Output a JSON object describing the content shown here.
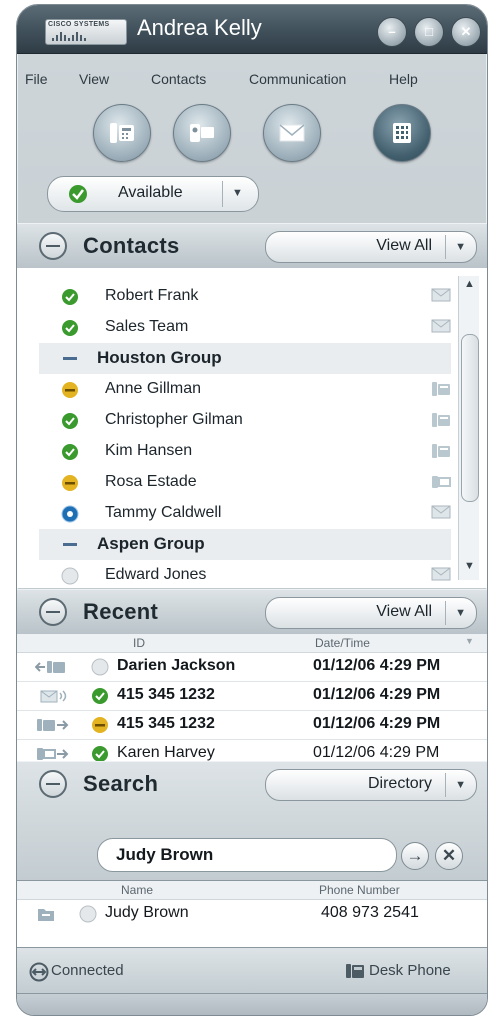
{
  "window": {
    "logo_text": "CISCO SYSTEMS",
    "title": "Andrea Kelly",
    "minimize_glyph": "–",
    "restore_glyph": "□",
    "close_glyph": "✕"
  },
  "menu": [
    "File",
    "View",
    "Contacts",
    "Communication",
    "Help"
  ],
  "toolbar_buttons": [
    "desk-phone-icon",
    "video-icon",
    "email-icon",
    "keypad-icon"
  ],
  "status": {
    "label": "Available",
    "icon": "status-available-icon"
  },
  "contacts": {
    "title": "Contacts",
    "filter": "View All",
    "rows": [
      {
        "type": "contact",
        "name": "Robert Frank",
        "status": "available",
        "icon": "email-icon"
      },
      {
        "type": "contact",
        "name": "Sales Team",
        "status": "available",
        "icon": "email-icon"
      },
      {
        "type": "group",
        "name": "Houston Group"
      },
      {
        "type": "contact",
        "name": "Anne Gillman",
        "status": "away",
        "icon": "phone-icon"
      },
      {
        "type": "contact",
        "name": "Christopher Gilman",
        "status": "available",
        "icon": "phone-icon"
      },
      {
        "type": "contact",
        "name": "Kim Hansen",
        "status": "available",
        "icon": "phone-icon"
      },
      {
        "type": "contact",
        "name": "Rosa Estade",
        "status": "away",
        "icon": "video-icon"
      },
      {
        "type": "contact",
        "name": "Tammy Caldwell",
        "status": "busy",
        "icon": "email-icon"
      },
      {
        "type": "group",
        "name": "Aspen Group"
      },
      {
        "type": "contact",
        "name": "Edward Jones",
        "status": "offline",
        "icon": "email-icon"
      }
    ]
  },
  "recent": {
    "title": "Recent",
    "filter": "View All",
    "columns": {
      "id": "ID",
      "datetime": "Date/Time"
    },
    "rows": [
      {
        "kind": "missed-call",
        "status": "offline",
        "id": "Darien Jackson",
        "datetime": "01/12/06 4:29 PM",
        "bold": true
      },
      {
        "kind": "voicemail",
        "status": "available",
        "id": "415 345 1232",
        "datetime": "01/12/06 4:29 PM",
        "bold": true
      },
      {
        "kind": "outgoing-call",
        "status": "away",
        "id": "415 345 1232",
        "datetime": "01/12/06 4:29 PM",
        "bold": true
      },
      {
        "kind": "outgoing-video",
        "status": "available",
        "id": "Karen Harvey",
        "datetime": "01/12/06 4:29 PM",
        "bold": false
      }
    ]
  },
  "search": {
    "title": "Search",
    "scope": "Directory",
    "query": "Judy Brown",
    "go_glyph": "→",
    "clear_glyph": "✕",
    "columns": {
      "name": "Name",
      "phone": "Phone Number"
    },
    "results": [
      {
        "name": "Judy Brown",
        "phone": "408 973 2541"
      }
    ]
  },
  "footer": {
    "connection": "Connected",
    "device": "Desk Phone"
  },
  "colors": {
    "available": "#3a9a2e",
    "away": "#e3b321",
    "busy": "#1f6fb5",
    "offline": "#d2d6d8"
  }
}
